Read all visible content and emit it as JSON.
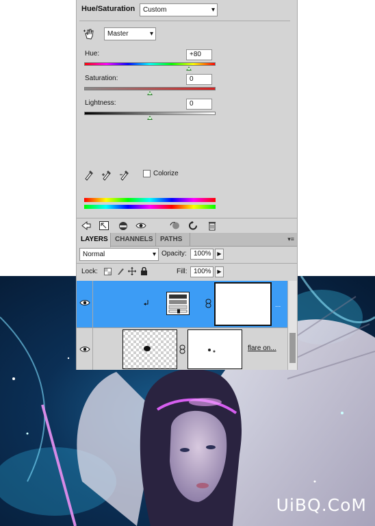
{
  "adjustments": {
    "title": "Hue/Saturation",
    "preset_value": "Custom",
    "channel_value": "Master",
    "hue_label": "Hue:",
    "hue_value": "+80",
    "saturation_label": "Saturation:",
    "saturation_value": "0",
    "lightness_label": "Lightness:",
    "lightness_value": "0",
    "colorize_label": "Colorize"
  },
  "layers": {
    "tabs": [
      "LAYERS",
      "CHANNELS",
      "PATHS"
    ],
    "blend_mode": "Normal",
    "opacity_label": "Opacity:",
    "opacity_value": "100%",
    "lock_label": "Lock:",
    "fill_label": "Fill:",
    "fill_value": "100%",
    "layer2_name": "flare on..."
  },
  "watermark": "UiBQ.CoM"
}
